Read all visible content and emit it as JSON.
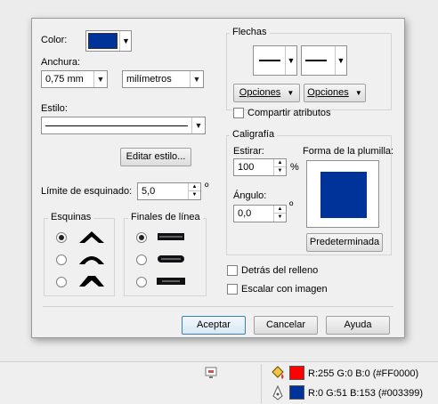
{
  "dialog": {
    "color_label": "Color:",
    "color_value": "#003399",
    "width_label": "Anchura:",
    "width_value": "0,75 mm",
    "units_value": "milímetros",
    "style_label": "Estilo:",
    "edit_style_button": "Editar estilo...",
    "miter_label": "Límite de esquinado:",
    "miter_value": "5,0",
    "miter_unit": "º",
    "corners_title": "Esquinas",
    "line_caps_title": "Finales de línea",
    "arrows_title": "Flechas",
    "options_left": "Opciones",
    "options_right": "Opciones",
    "share_attributes": "Compartir atributos",
    "calligraphy_title": "Caligrafía",
    "stretch_label": "Estirar:",
    "stretch_value": "100",
    "stretch_unit": "%",
    "nib_shape_label": "Forma de la plumilla:",
    "angle_label": "Ángulo:",
    "angle_value": "0,0",
    "angle_unit": "º",
    "default_button": "Predeterminada",
    "behind_fill": "Detrás del relleno",
    "scale_with_image": "Escalar con imagen",
    "ok_button": "Aceptar",
    "cancel_button": "Cancelar",
    "help_button": "Ayuda"
  },
  "status": {
    "fill_text": "R:255 G:0 B:0 (#FF0000)",
    "fill_color": "#ff0000",
    "outline_text": "R:0 G:51 B:153 (#003399)",
    "outline_color": "#003399"
  },
  "icons": {
    "corner_miter": "corner-miter-icon",
    "corner_round": "corner-round-icon",
    "corner_bevel": "corner-bevel-icon",
    "cap_butt": "cap-butt-icon",
    "cap_round": "cap-round-icon",
    "cap_square": "cap-square-icon",
    "fill_bucket": "fill-bucket-icon",
    "outline_pen": "outline-pen-icon"
  },
  "colors": {
    "accent": "#003399",
    "button_primary_border": "#3c7fb1"
  }
}
